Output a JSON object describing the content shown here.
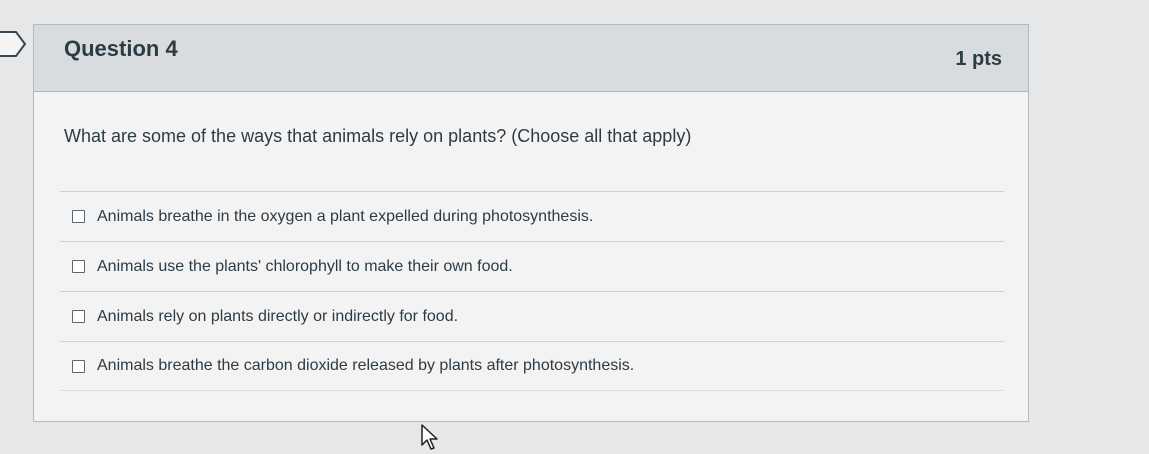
{
  "question": {
    "title": "Question 4",
    "points": "1 pts",
    "text": "What are some of the ways that animals rely on plants? (Choose all that apply)",
    "answers": [
      {
        "label": "Animals breathe in the oxygen a plant expelled during photosynthesis.",
        "checked": false
      },
      {
        "label": "Animals use the plants' chlorophyll to make their own food.",
        "checked": false
      },
      {
        "label": "Animals rely on plants directly or indirectly for food.",
        "checked": false
      },
      {
        "label": "Animals breathe the carbon dioxide released by plants after photosynthesis.",
        "checked": false
      }
    ]
  },
  "icons": {
    "flag": "question-flag-icon",
    "cursor": "mouse-pointer-icon"
  },
  "colors": {
    "header_bg": "#d9dcde",
    "text": "#2d3b45",
    "page_bg": "#e6e7e8"
  }
}
